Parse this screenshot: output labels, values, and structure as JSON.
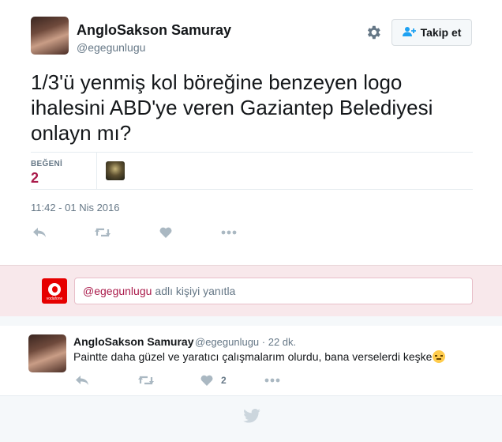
{
  "tweet": {
    "author_name": "AngloSakson Samuray",
    "author_handle": "@egegunlugu",
    "follow_label": "Takip et",
    "text": "1/3'ü yenmiş kol böreğine benzeyen logo ihalesini ABD'ye veren Gaziantep Belediyesi onlayn mı?",
    "likes_label": "BEĞENİ",
    "likes_count": "2",
    "timestamp": "11:42 - 01 Nis 2016"
  },
  "reply_box": {
    "mention": "@egegunlugu",
    "prompt": "adlı kişiyi yanıtla",
    "avatar_caption": "vodafone"
  },
  "reply": {
    "author_name": "AngloSakson Samuray",
    "meta": "@egegunlugu · 22 dk.",
    "text": "Paintte daha güzel ve yaratıcı çalışmalarım olurdu, bana verselerdi keşke",
    "like_count": "2"
  },
  "icons": [
    "gear-icon",
    "follow-user-icon",
    "reply-icon",
    "retweet-icon",
    "like-icon",
    "more-icon",
    "twitter-bird-icon",
    "unamused-emoji-icon"
  ],
  "colors": {
    "accent": "#aa1b4b",
    "reply_bg": "#f8e8eb",
    "muted": "#657786"
  }
}
